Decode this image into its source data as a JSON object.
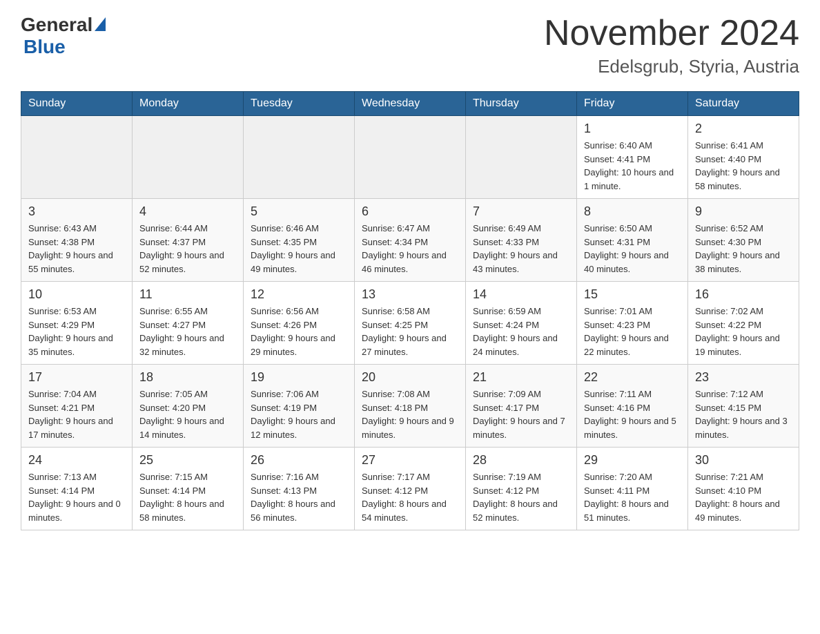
{
  "header": {
    "logo": {
      "general": "General",
      "blue": "Blue"
    },
    "title": "November 2024",
    "location": "Edelsgrub, Styria, Austria"
  },
  "calendar": {
    "days_of_week": [
      "Sunday",
      "Monday",
      "Tuesday",
      "Wednesday",
      "Thursday",
      "Friday",
      "Saturday"
    ],
    "weeks": [
      [
        {
          "day": "",
          "info": ""
        },
        {
          "day": "",
          "info": ""
        },
        {
          "day": "",
          "info": ""
        },
        {
          "day": "",
          "info": ""
        },
        {
          "day": "",
          "info": ""
        },
        {
          "day": "1",
          "info": "Sunrise: 6:40 AM\nSunset: 4:41 PM\nDaylight: 10 hours and 1 minute."
        },
        {
          "day": "2",
          "info": "Sunrise: 6:41 AM\nSunset: 4:40 PM\nDaylight: 9 hours and 58 minutes."
        }
      ],
      [
        {
          "day": "3",
          "info": "Sunrise: 6:43 AM\nSunset: 4:38 PM\nDaylight: 9 hours and 55 minutes."
        },
        {
          "day": "4",
          "info": "Sunrise: 6:44 AM\nSunset: 4:37 PM\nDaylight: 9 hours and 52 minutes."
        },
        {
          "day": "5",
          "info": "Sunrise: 6:46 AM\nSunset: 4:35 PM\nDaylight: 9 hours and 49 minutes."
        },
        {
          "day": "6",
          "info": "Sunrise: 6:47 AM\nSunset: 4:34 PM\nDaylight: 9 hours and 46 minutes."
        },
        {
          "day": "7",
          "info": "Sunrise: 6:49 AM\nSunset: 4:33 PM\nDaylight: 9 hours and 43 minutes."
        },
        {
          "day": "8",
          "info": "Sunrise: 6:50 AM\nSunset: 4:31 PM\nDaylight: 9 hours and 40 minutes."
        },
        {
          "day": "9",
          "info": "Sunrise: 6:52 AM\nSunset: 4:30 PM\nDaylight: 9 hours and 38 minutes."
        }
      ],
      [
        {
          "day": "10",
          "info": "Sunrise: 6:53 AM\nSunset: 4:29 PM\nDaylight: 9 hours and 35 minutes."
        },
        {
          "day": "11",
          "info": "Sunrise: 6:55 AM\nSunset: 4:27 PM\nDaylight: 9 hours and 32 minutes."
        },
        {
          "day": "12",
          "info": "Sunrise: 6:56 AM\nSunset: 4:26 PM\nDaylight: 9 hours and 29 minutes."
        },
        {
          "day": "13",
          "info": "Sunrise: 6:58 AM\nSunset: 4:25 PM\nDaylight: 9 hours and 27 minutes."
        },
        {
          "day": "14",
          "info": "Sunrise: 6:59 AM\nSunset: 4:24 PM\nDaylight: 9 hours and 24 minutes."
        },
        {
          "day": "15",
          "info": "Sunrise: 7:01 AM\nSunset: 4:23 PM\nDaylight: 9 hours and 22 minutes."
        },
        {
          "day": "16",
          "info": "Sunrise: 7:02 AM\nSunset: 4:22 PM\nDaylight: 9 hours and 19 minutes."
        }
      ],
      [
        {
          "day": "17",
          "info": "Sunrise: 7:04 AM\nSunset: 4:21 PM\nDaylight: 9 hours and 17 minutes."
        },
        {
          "day": "18",
          "info": "Sunrise: 7:05 AM\nSunset: 4:20 PM\nDaylight: 9 hours and 14 minutes."
        },
        {
          "day": "19",
          "info": "Sunrise: 7:06 AM\nSunset: 4:19 PM\nDaylight: 9 hours and 12 minutes."
        },
        {
          "day": "20",
          "info": "Sunrise: 7:08 AM\nSunset: 4:18 PM\nDaylight: 9 hours and 9 minutes."
        },
        {
          "day": "21",
          "info": "Sunrise: 7:09 AM\nSunset: 4:17 PM\nDaylight: 9 hours and 7 minutes."
        },
        {
          "day": "22",
          "info": "Sunrise: 7:11 AM\nSunset: 4:16 PM\nDaylight: 9 hours and 5 minutes."
        },
        {
          "day": "23",
          "info": "Sunrise: 7:12 AM\nSunset: 4:15 PM\nDaylight: 9 hours and 3 minutes."
        }
      ],
      [
        {
          "day": "24",
          "info": "Sunrise: 7:13 AM\nSunset: 4:14 PM\nDaylight: 9 hours and 0 minutes."
        },
        {
          "day": "25",
          "info": "Sunrise: 7:15 AM\nSunset: 4:14 PM\nDaylight: 8 hours and 58 minutes."
        },
        {
          "day": "26",
          "info": "Sunrise: 7:16 AM\nSunset: 4:13 PM\nDaylight: 8 hours and 56 minutes."
        },
        {
          "day": "27",
          "info": "Sunrise: 7:17 AM\nSunset: 4:12 PM\nDaylight: 8 hours and 54 minutes."
        },
        {
          "day": "28",
          "info": "Sunrise: 7:19 AM\nSunset: 4:12 PM\nDaylight: 8 hours and 52 minutes."
        },
        {
          "day": "29",
          "info": "Sunrise: 7:20 AM\nSunset: 4:11 PM\nDaylight: 8 hours and 51 minutes."
        },
        {
          "day": "30",
          "info": "Sunrise: 7:21 AM\nSunset: 4:10 PM\nDaylight: 8 hours and 49 minutes."
        }
      ]
    ]
  }
}
